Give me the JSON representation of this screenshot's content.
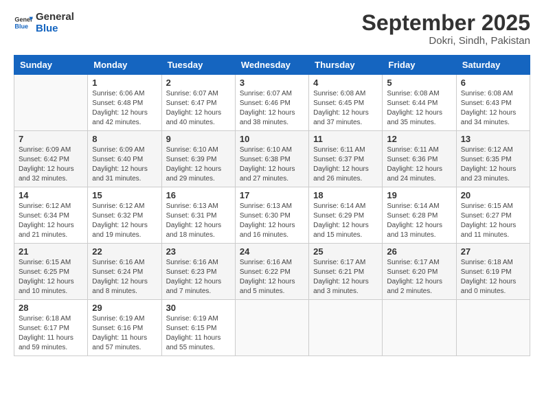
{
  "logo": {
    "line1": "General",
    "line2": "Blue"
  },
  "title": "September 2025",
  "subtitle": "Dokri, Sindh, Pakistan",
  "headers": [
    "Sunday",
    "Monday",
    "Tuesday",
    "Wednesday",
    "Thursday",
    "Friday",
    "Saturday"
  ],
  "weeks": [
    [
      {
        "day": "",
        "info": ""
      },
      {
        "day": "1",
        "info": "Sunrise: 6:06 AM\nSunset: 6:48 PM\nDaylight: 12 hours\nand 42 minutes."
      },
      {
        "day": "2",
        "info": "Sunrise: 6:07 AM\nSunset: 6:47 PM\nDaylight: 12 hours\nand 40 minutes."
      },
      {
        "day": "3",
        "info": "Sunrise: 6:07 AM\nSunset: 6:46 PM\nDaylight: 12 hours\nand 38 minutes."
      },
      {
        "day": "4",
        "info": "Sunrise: 6:08 AM\nSunset: 6:45 PM\nDaylight: 12 hours\nand 37 minutes."
      },
      {
        "day": "5",
        "info": "Sunrise: 6:08 AM\nSunset: 6:44 PM\nDaylight: 12 hours\nand 35 minutes."
      },
      {
        "day": "6",
        "info": "Sunrise: 6:08 AM\nSunset: 6:43 PM\nDaylight: 12 hours\nand 34 minutes."
      }
    ],
    [
      {
        "day": "7",
        "info": "Sunrise: 6:09 AM\nSunset: 6:42 PM\nDaylight: 12 hours\nand 32 minutes."
      },
      {
        "day": "8",
        "info": "Sunrise: 6:09 AM\nSunset: 6:40 PM\nDaylight: 12 hours\nand 31 minutes."
      },
      {
        "day": "9",
        "info": "Sunrise: 6:10 AM\nSunset: 6:39 PM\nDaylight: 12 hours\nand 29 minutes."
      },
      {
        "day": "10",
        "info": "Sunrise: 6:10 AM\nSunset: 6:38 PM\nDaylight: 12 hours\nand 27 minutes."
      },
      {
        "day": "11",
        "info": "Sunrise: 6:11 AM\nSunset: 6:37 PM\nDaylight: 12 hours\nand 26 minutes."
      },
      {
        "day": "12",
        "info": "Sunrise: 6:11 AM\nSunset: 6:36 PM\nDaylight: 12 hours\nand 24 minutes."
      },
      {
        "day": "13",
        "info": "Sunrise: 6:12 AM\nSunset: 6:35 PM\nDaylight: 12 hours\nand 23 minutes."
      }
    ],
    [
      {
        "day": "14",
        "info": "Sunrise: 6:12 AM\nSunset: 6:34 PM\nDaylight: 12 hours\nand 21 minutes."
      },
      {
        "day": "15",
        "info": "Sunrise: 6:12 AM\nSunset: 6:32 PM\nDaylight: 12 hours\nand 19 minutes."
      },
      {
        "day": "16",
        "info": "Sunrise: 6:13 AM\nSunset: 6:31 PM\nDaylight: 12 hours\nand 18 minutes."
      },
      {
        "day": "17",
        "info": "Sunrise: 6:13 AM\nSunset: 6:30 PM\nDaylight: 12 hours\nand 16 minutes."
      },
      {
        "day": "18",
        "info": "Sunrise: 6:14 AM\nSunset: 6:29 PM\nDaylight: 12 hours\nand 15 minutes."
      },
      {
        "day": "19",
        "info": "Sunrise: 6:14 AM\nSunset: 6:28 PM\nDaylight: 12 hours\nand 13 minutes."
      },
      {
        "day": "20",
        "info": "Sunrise: 6:15 AM\nSunset: 6:27 PM\nDaylight: 12 hours\nand 11 minutes."
      }
    ],
    [
      {
        "day": "21",
        "info": "Sunrise: 6:15 AM\nSunset: 6:25 PM\nDaylight: 12 hours\nand 10 minutes."
      },
      {
        "day": "22",
        "info": "Sunrise: 6:16 AM\nSunset: 6:24 PM\nDaylight: 12 hours\nand 8 minutes."
      },
      {
        "day": "23",
        "info": "Sunrise: 6:16 AM\nSunset: 6:23 PM\nDaylight: 12 hours\nand 7 minutes."
      },
      {
        "day": "24",
        "info": "Sunrise: 6:16 AM\nSunset: 6:22 PM\nDaylight: 12 hours\nand 5 minutes."
      },
      {
        "day": "25",
        "info": "Sunrise: 6:17 AM\nSunset: 6:21 PM\nDaylight: 12 hours\nand 3 minutes."
      },
      {
        "day": "26",
        "info": "Sunrise: 6:17 AM\nSunset: 6:20 PM\nDaylight: 12 hours\nand 2 minutes."
      },
      {
        "day": "27",
        "info": "Sunrise: 6:18 AM\nSunset: 6:19 PM\nDaylight: 12 hours\nand 0 minutes."
      }
    ],
    [
      {
        "day": "28",
        "info": "Sunrise: 6:18 AM\nSunset: 6:17 PM\nDaylight: 11 hours\nand 59 minutes."
      },
      {
        "day": "29",
        "info": "Sunrise: 6:19 AM\nSunset: 6:16 PM\nDaylight: 11 hours\nand 57 minutes."
      },
      {
        "day": "30",
        "info": "Sunrise: 6:19 AM\nSunset: 6:15 PM\nDaylight: 11 hours\nand 55 minutes."
      },
      {
        "day": "",
        "info": ""
      },
      {
        "day": "",
        "info": ""
      },
      {
        "day": "",
        "info": ""
      },
      {
        "day": "",
        "info": ""
      }
    ]
  ]
}
